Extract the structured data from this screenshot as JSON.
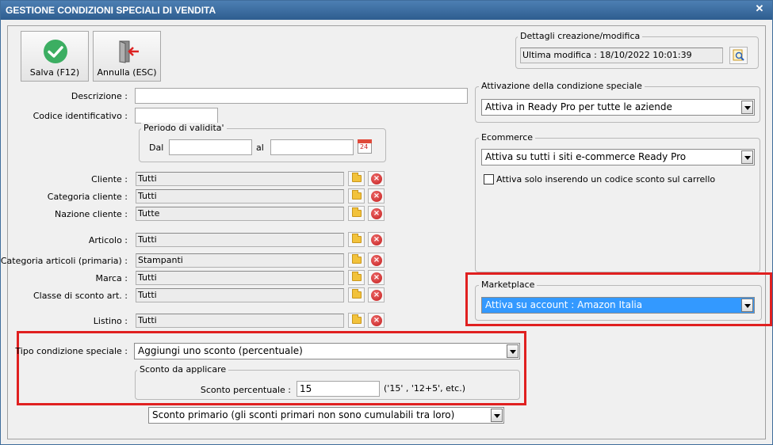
{
  "window": {
    "title": "GESTIONE CONDIZIONI SPECIALI DI VENDITA",
    "close_glyph": "✕"
  },
  "toolbar": {
    "save_label": "Salva (F12)",
    "cancel_label": "Annulla (ESC)"
  },
  "form": {
    "descrizione_label": "Descrizione :",
    "descrizione_value": "",
    "codice_label": "Codice identificativo :",
    "codice_value": "",
    "periodo": {
      "title": "Periodo di validita'",
      "dal_label": "Dal",
      "dal_value": "",
      "al_label": "al",
      "al_value": "",
      "calendar_day": "24"
    },
    "filters": [
      {
        "label": "Cliente :",
        "value": "Tutti"
      },
      {
        "label": "Categoria cliente :",
        "value": "Tutti"
      },
      {
        "label": "Nazione cliente :",
        "value": "Tutte"
      },
      {
        "label": "Articolo :",
        "value": "Tutti"
      },
      {
        "label": "Categoria articoli (primaria) :",
        "value": "Stampanti"
      },
      {
        "label": "Marca :",
        "value": "Tutti"
      },
      {
        "label": "Classe di sconto art. :",
        "value": "Tutti"
      },
      {
        "label": "Listino :",
        "value": "Tutti"
      }
    ]
  },
  "tipo": {
    "label": "Tipo condizione speciale :",
    "value": "Aggiungi uno sconto (percentuale)",
    "sconto_group_title": "Sconto da applicare",
    "sconto_label": "Sconto percentuale :",
    "sconto_value": "15",
    "sconto_hint": "('15' ,  '12+5', etc.)",
    "primario_value": "Sconto primario (gli sconti primari non sono cumulabili tra loro)"
  },
  "dettagli": {
    "title": "Dettagli creazione/modifica",
    "value": "Ultima modifica : 18/10/2022  10:01:39"
  },
  "attivazione": {
    "title": "Attivazione della condizione speciale",
    "value": "Attiva in Ready Pro per tutte le aziende"
  },
  "ecommerce": {
    "title": "Ecommerce",
    "value": "Attiva su tutti i siti e-commerce Ready Pro",
    "checkbox_label": "Attiva solo inserendo un codice sconto sul carrello",
    "checked": false
  },
  "marketplace": {
    "title": "Marketplace",
    "value": "Attiva su account : Amazon Italia"
  },
  "colors": {
    "title_bar": "#2e5d8f",
    "highlight_red": "#e02020",
    "selection_blue": "#3399ff",
    "save_green": "#3cae62"
  }
}
